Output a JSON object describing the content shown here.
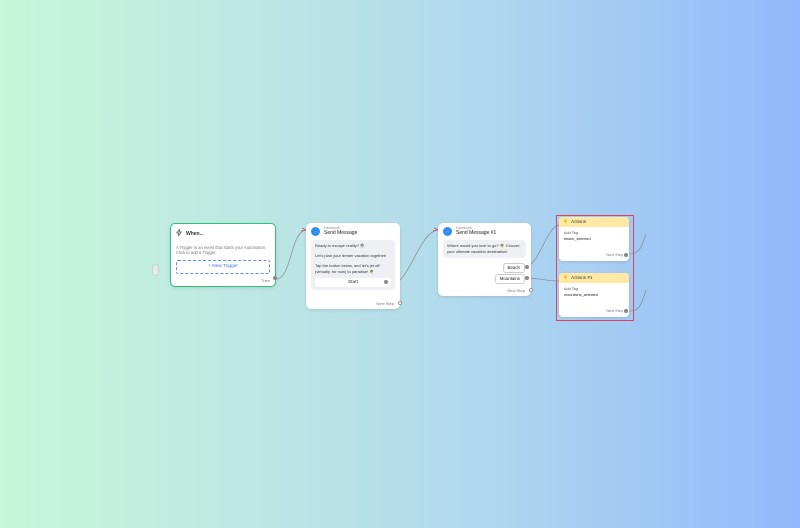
{
  "trigger": {
    "title": "When...",
    "description": "A Trigger is an event that starts your Automation. Click to add a Trigger.",
    "new_trigger_label": "+ New Trigger",
    "then_label": "Then",
    "icon": "bolt-outline-icon",
    "border_color": "#33c27a"
  },
  "message1": {
    "source": "Facebook",
    "title": "Send Message",
    "lines": [
      "Ready to escape reality? 😎",
      "Let's plan your dream vacation together!",
      "Tap the button below, and let's jet off (virtually, for now) to paradise! 🌴"
    ],
    "button_label": "Start",
    "next_label": "Next Step"
  },
  "message2": {
    "source": "Facebook",
    "title": "Send Message #1",
    "text": "Where would you love to go? 🌴 Choose your ultimate vacation destination!",
    "choices": [
      "Beach",
      "Mountains"
    ],
    "next_label": "Next Step"
  },
  "actions": [
    {
      "title": "Actions",
      "body_label": "Add Tag",
      "tag": "beach_selected",
      "next_label": "Next Step"
    },
    {
      "title": "Actions #1",
      "body_label": "Add Tag",
      "tag": "mountains_selected",
      "next_label": "Next Step"
    }
  ],
  "colors": {
    "accent_blue": "#2e8cf6",
    "actions_header": "#ffe8a3",
    "selection_frame": "#d9435c"
  }
}
